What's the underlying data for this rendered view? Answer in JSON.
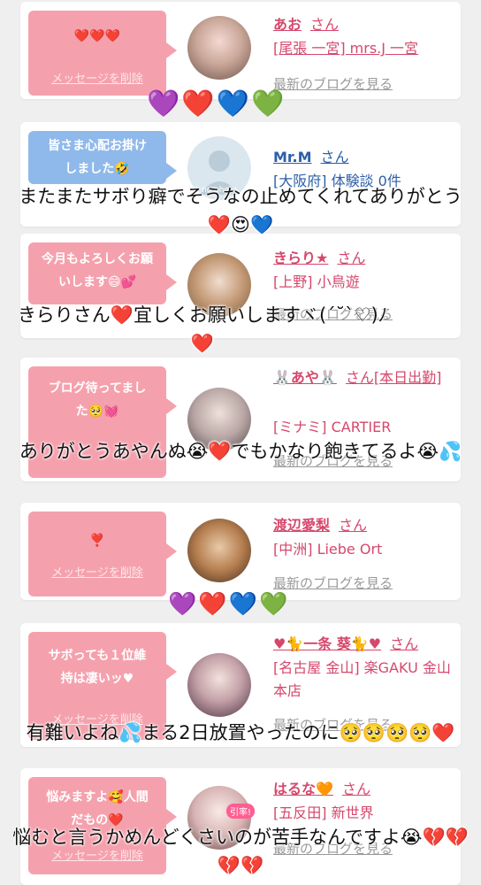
{
  "cards": [
    {
      "message": "❤️❤️❤️",
      "delete_label": "メッセージを削除",
      "name": "あお",
      "san": "さん",
      "shop": "[尾張 一宮] mrs.J 一宮",
      "blog": "最新のブログを見る"
    },
    {
      "message": "皆さま心配お掛けしました🤣",
      "name": "Mr.M",
      "san": "さん",
      "shop": "[大阪府] 体験談 0件",
      "avatar_text": "no photo"
    },
    {
      "message": "今月もよろしくお願いします😄💕",
      "name": "きらり★",
      "san": "さん",
      "shop": "[上野] 小鳥遊",
      "blog": "最新のブログを見る"
    },
    {
      "message": "ブログ待ってました🥺💓",
      "name": "🐰あや🐰",
      "san": "さん[本日出勤]",
      "shop": "[ミナミ] CARTIER",
      "blog": "最新のブログを見る"
    },
    {
      "message": "❣️",
      "delete_label": "メッセージを削除",
      "name": "渡辺愛梨",
      "san": "さん",
      "shop": "[中洲] Liebe Ort",
      "blog": "最新のブログを見る"
    },
    {
      "message": "サボっても１位維持は凄いッ♥",
      "delete_label": "メッセージを削除",
      "name": "♥🐈一条 葵🐈♥",
      "san": "さん",
      "shop": "[名古屋 金山] 楽GAKU 金山本店",
      "blog": "最新のブログを見る"
    },
    {
      "message": "悩みますよ🥰人間だもの❤️",
      "delete_label": "メッセージを削除",
      "name": "はるな🧡",
      "san": "さん",
      "shop": "[五反田] 新世界",
      "blog": "最新のブログを見る",
      "avatar_badge": "引率!"
    }
  ],
  "hearts_row": [
    "💜",
    "❤️",
    "💙",
    "💚"
  ],
  "overlays": [
    "またまたサボり癖でそうなの止めてくれてありがとう❤️😍💙",
    "きらりさん❤️宜しくお願いしますヾ(ˊ˘ˋ♡)ﾉ❤️",
    "ありがとうあやんぬ😭❤️でもかなり飽きてるよ😭💦",
    "有難いよね💦まる2日放置やったのに🥺🥺🥺🥺❤️",
    "悩むと言うかめんどくさいのが苦手なんですよ😭💔💔💔💔"
  ],
  "colors": {
    "accent_pink": "#d6476c",
    "bubble_pink": "#f5a1ad",
    "bubble_blue": "#8fb9ea",
    "name_blue": "#2d5fa8"
  }
}
